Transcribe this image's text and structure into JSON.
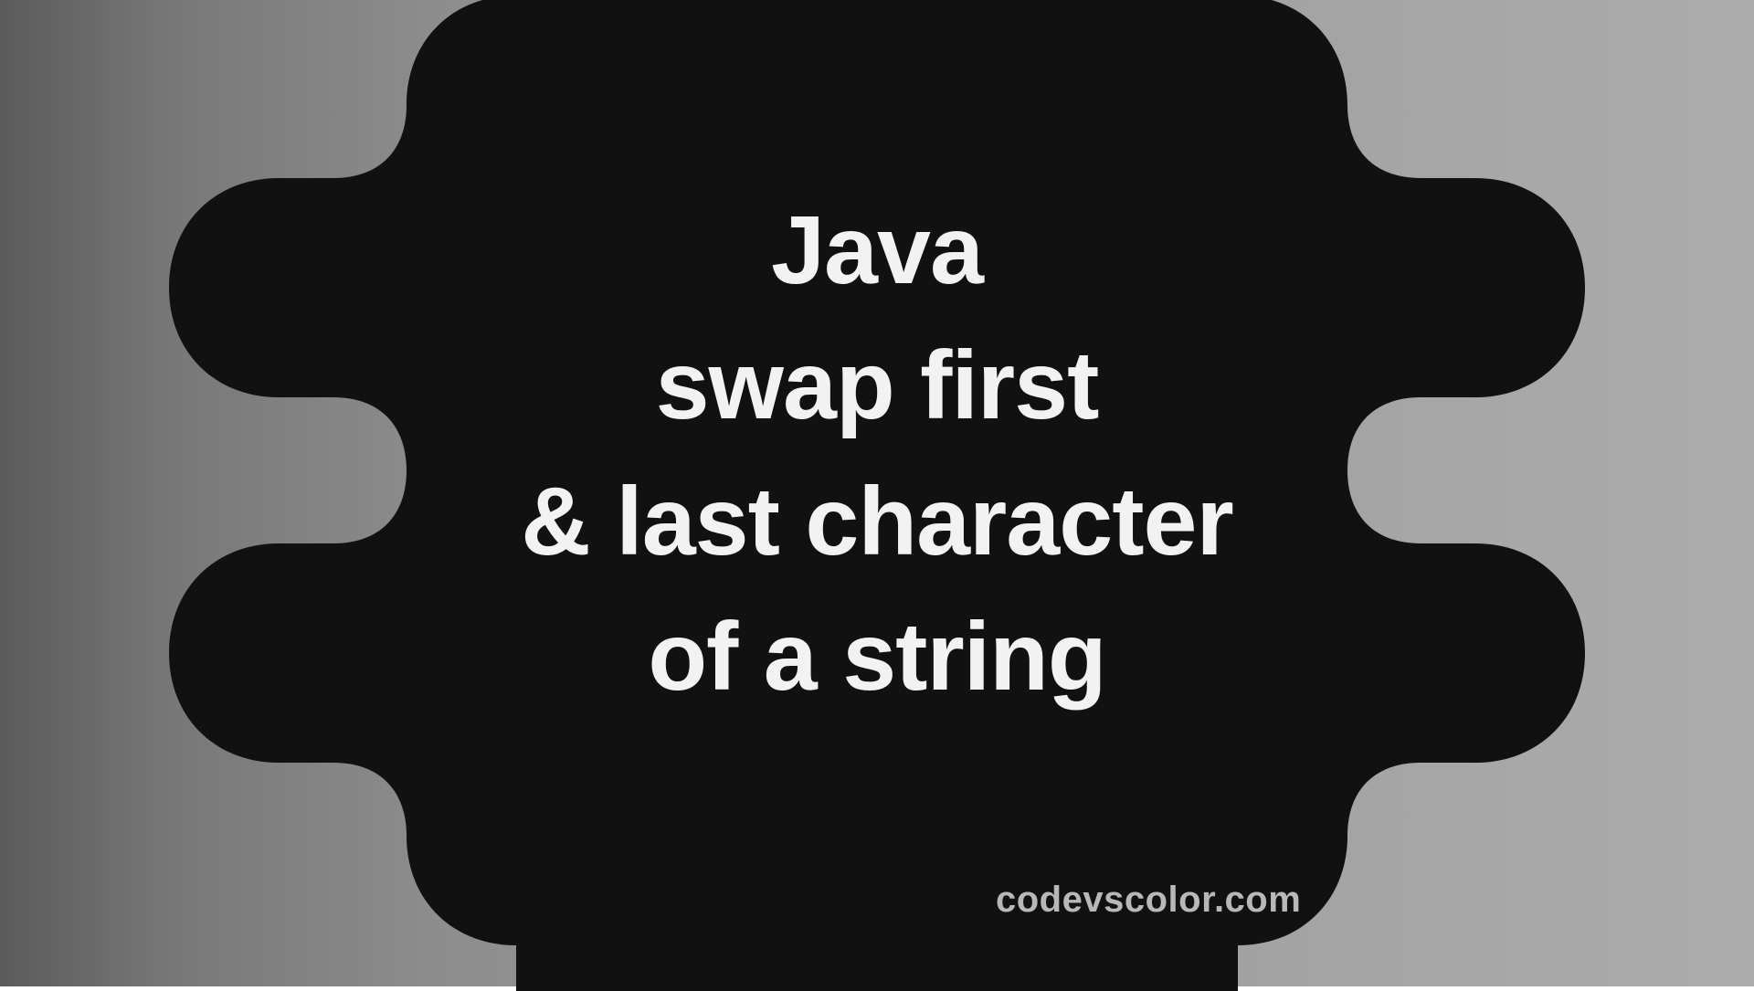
{
  "title": {
    "line1": "Java",
    "line2": "swap first",
    "line3": "& last character",
    "line4": "of a string"
  },
  "watermark": "codevscolor.com",
  "colors": {
    "blob": "#111111",
    "text": "#f2f2f2",
    "watermark": "#b8b8b8",
    "bgGradient": [
      "#5b5b5b",
      "#acacac"
    ]
  }
}
